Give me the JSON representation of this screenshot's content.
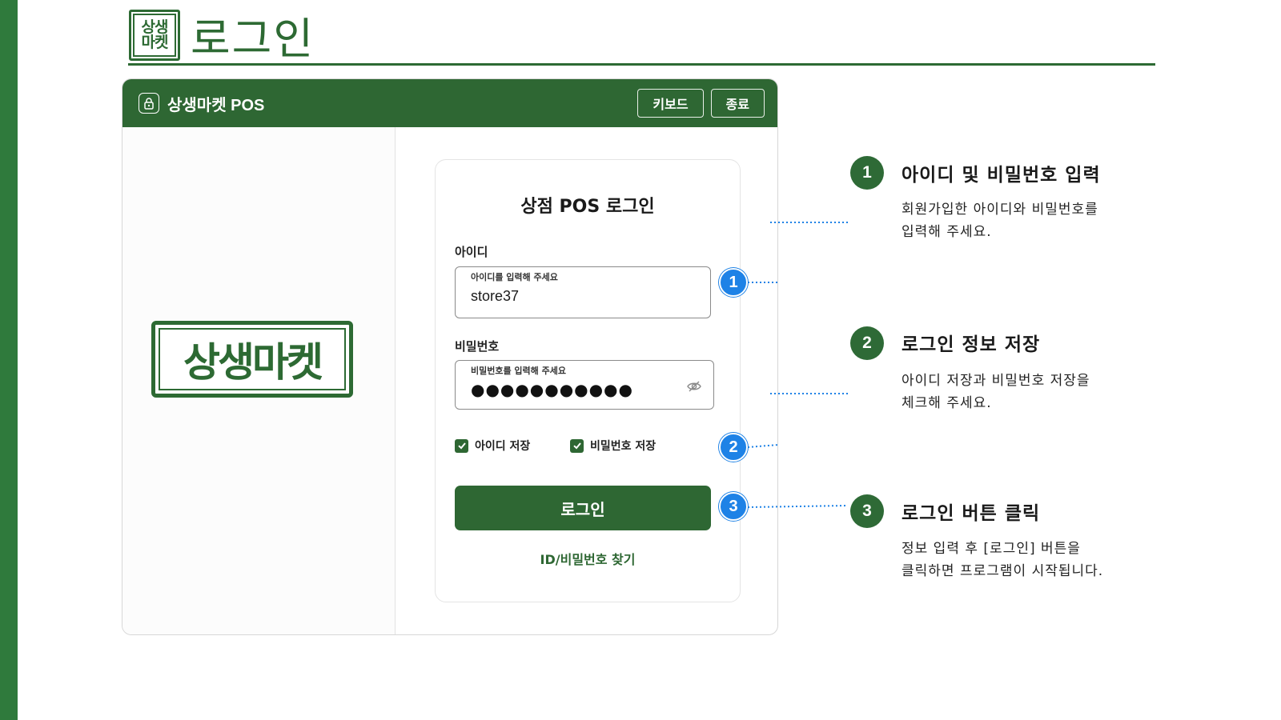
{
  "page": {
    "title": "로그인",
    "logo_lines": [
      "상생",
      "마켓"
    ]
  },
  "window": {
    "title": "상생마켓 POS",
    "keyboard_label": "키보드",
    "exit_label": "종료",
    "brand_logo_text": "상생마켓"
  },
  "login": {
    "title": "상점 POS 로그인",
    "id_label": "아이디",
    "id_placeholder": "아이디를 입력해 주세요",
    "id_value": "store37",
    "pw_label": "비밀번호",
    "pw_placeholder": "비밀번호를 입력해 주세요",
    "pw_masked": "●●●●●●●●●●●",
    "save_id_label": "아이디 저장",
    "save_pw_label": "비밀번호 저장",
    "save_id_checked": true,
    "save_pw_checked": true,
    "login_button": "로그인",
    "find_link": "ID/비밀번호 찾기"
  },
  "markers": [
    "1",
    "2",
    "3"
  ],
  "steps": [
    {
      "num": "1",
      "title": "아이디 및 비밀번호 입력",
      "desc": [
        "회원가입한 아이디와 비밀번호를",
        "입력해 주세요."
      ]
    },
    {
      "num": "2",
      "title": "로그인 정보 저장",
      "desc": [
        "아이디 저장과 비밀번호 저장을",
        "체크해 주세요."
      ]
    },
    {
      "num": "3",
      "title": "로그인 버튼 클릭",
      "desc": [
        "정보 입력 후 [로그인] 버튼을",
        "클릭하면 프로그램이 시작됩니다."
      ]
    }
  ],
  "colors": {
    "brand_green": "#2e6733",
    "marker_blue": "#1e82e6",
    "left_bar": "#2f7a3c"
  },
  "icons": {
    "lock": "lock-icon",
    "eye_off": "eye-off-icon",
    "check": "check-icon"
  }
}
